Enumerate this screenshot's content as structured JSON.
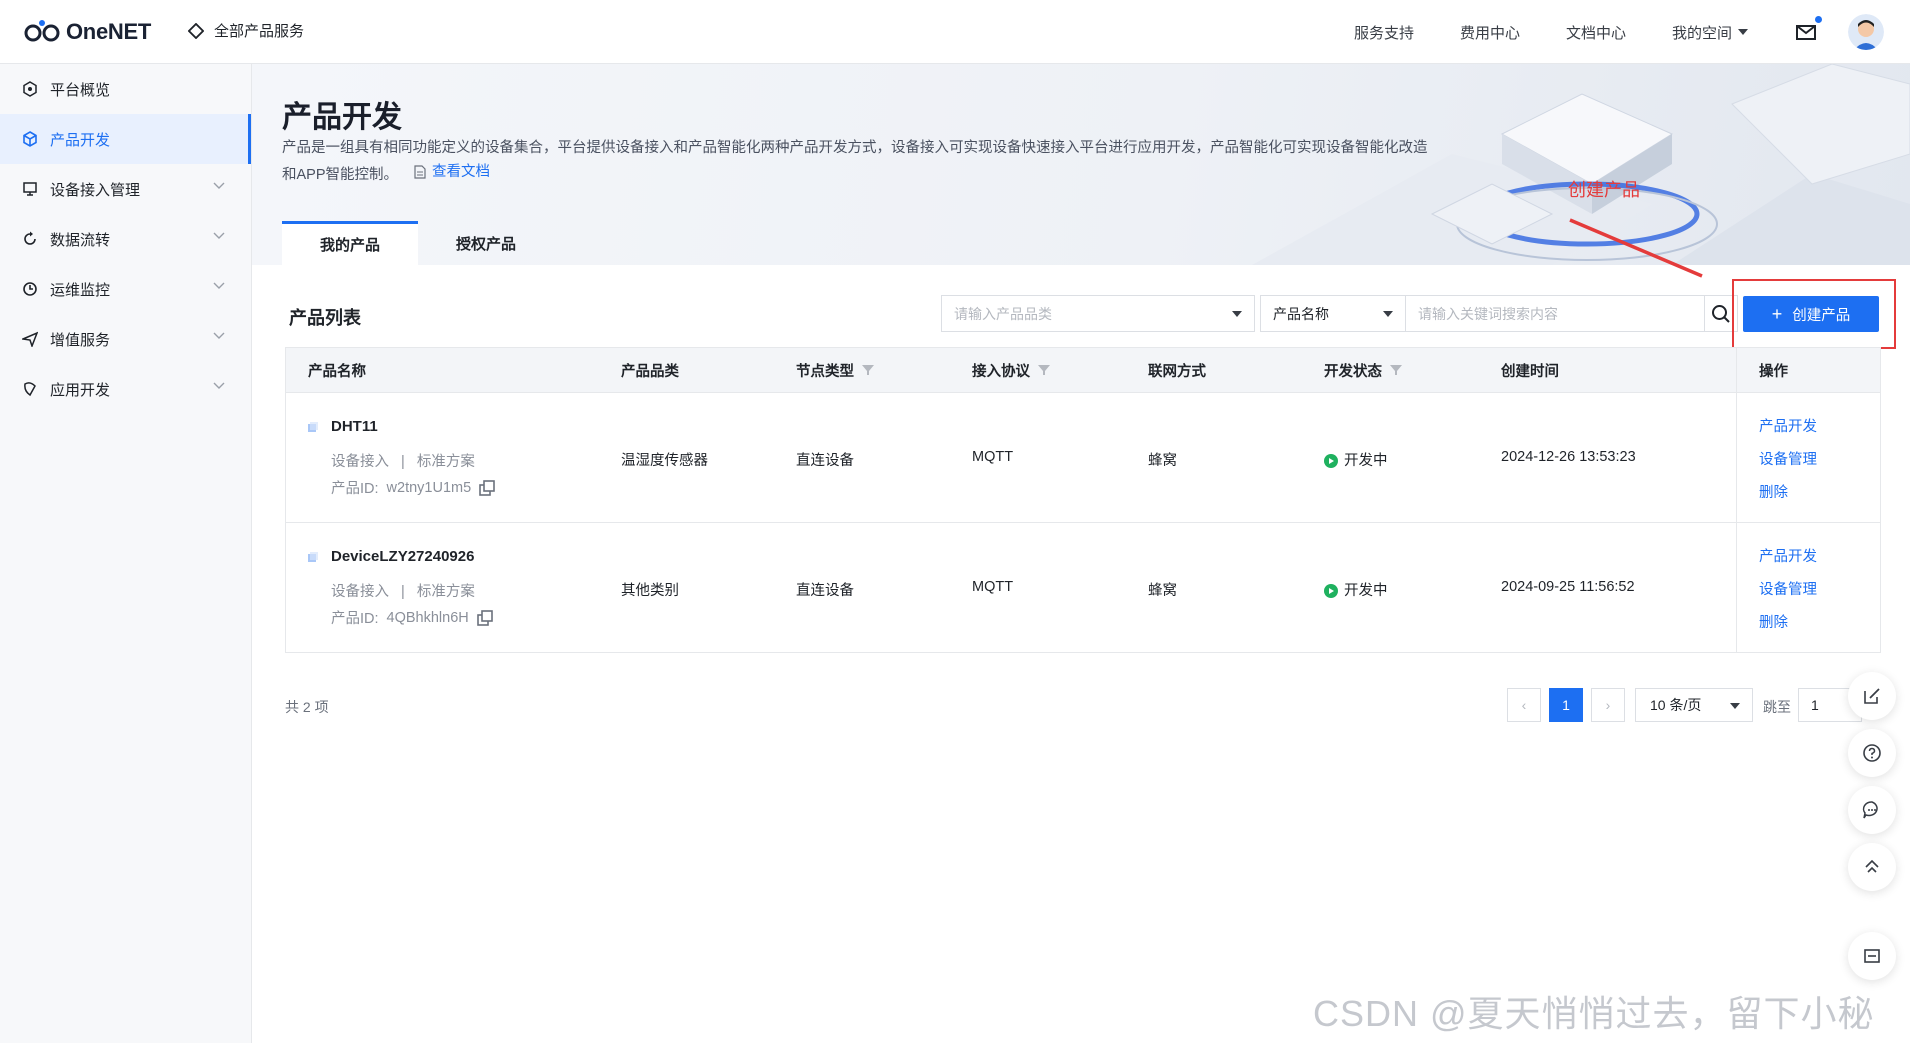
{
  "topbar": {
    "logo_text": "OneNET",
    "all_products": "全部产品服务",
    "nav": [
      "服务支持",
      "费用中心",
      "文档中心",
      "我的空间"
    ],
    "mail_icon": "mail-icon",
    "avatar_icon": "avatar-icon"
  },
  "sidebar": {
    "items": [
      {
        "label": "平台概览",
        "icon": "overview-icon",
        "expandable": false,
        "active": false
      },
      {
        "label": "产品开发",
        "icon": "cube-icon",
        "expandable": false,
        "active": true
      },
      {
        "label": "设备接入管理",
        "icon": "device-icon",
        "expandable": true,
        "active": false
      },
      {
        "label": "数据流转",
        "icon": "flow-icon",
        "expandable": true,
        "active": false
      },
      {
        "label": "运维监控",
        "icon": "monitor-icon",
        "expandable": true,
        "active": false
      },
      {
        "label": "增值服务",
        "icon": "send-icon",
        "expandable": true,
        "active": false
      },
      {
        "label": "应用开发",
        "icon": "app-icon",
        "expandable": true,
        "active": false
      }
    ]
  },
  "page": {
    "title": "产品开发",
    "description": "产品是一组具有相同功能定义的设备集合，平台提供设备接入和产品智能化两种产品开发方式，设备接入可实现设备快速接入平台进行应用开发，产品智能化可实现设备智能化改造和APP智能控制。",
    "doc_link": "查看文档",
    "tabs": [
      "我的产品",
      "授权产品"
    ],
    "active_tab": 0
  },
  "annotation": {
    "text": "创建产品",
    "color": "#e43b3b"
  },
  "list": {
    "title": "产品列表",
    "category_placeholder": "请输入产品品类",
    "field_select": "产品名称",
    "keyword_placeholder": "请输入关键词搜索内容",
    "create_label": "创建产品",
    "columns": [
      "产品名称",
      "产品品类",
      "节点类型",
      "接入协议",
      "联网方式",
      "开发状态",
      "创建时间",
      "操作"
    ],
    "rows": [
      {
        "name": "DHT11",
        "access": "设备接入",
        "scheme": "标准方案",
        "id_label": "产品ID:",
        "id": "w2tny1U1m5",
        "category": "温湿度传感器",
        "node_type": "直连设备",
        "protocol": "MQTT",
        "network": "蜂窝",
        "status": "开发中",
        "created": "2024-12-26 13:53:23",
        "ops": [
          "产品开发",
          "设备管理",
          "删除"
        ]
      },
      {
        "name": "DeviceLZY27240926",
        "access": "设备接入",
        "scheme": "标准方案",
        "id_label": "产品ID:",
        "id": "4QBhkhln6H",
        "category": "其他类别",
        "node_type": "直连设备",
        "protocol": "MQTT",
        "network": "蜂窝",
        "status": "开发中",
        "created": "2024-09-25 11:56:52",
        "ops": [
          "产品开发",
          "设备管理",
          "删除"
        ]
      }
    ],
    "separator": "|"
  },
  "pagination": {
    "total": "共 2 项",
    "prev": "‹",
    "current": "1",
    "next": "›",
    "page_size": "10 条/页",
    "jump_label": "跳至",
    "jump_value": "1"
  },
  "watermark": "CSDN @夏天悄悄过去，留下小秘密",
  "colors": {
    "accent": "#1d6ff2",
    "status_green": "#1fb15f",
    "annotation_red": "#e43b3b"
  }
}
